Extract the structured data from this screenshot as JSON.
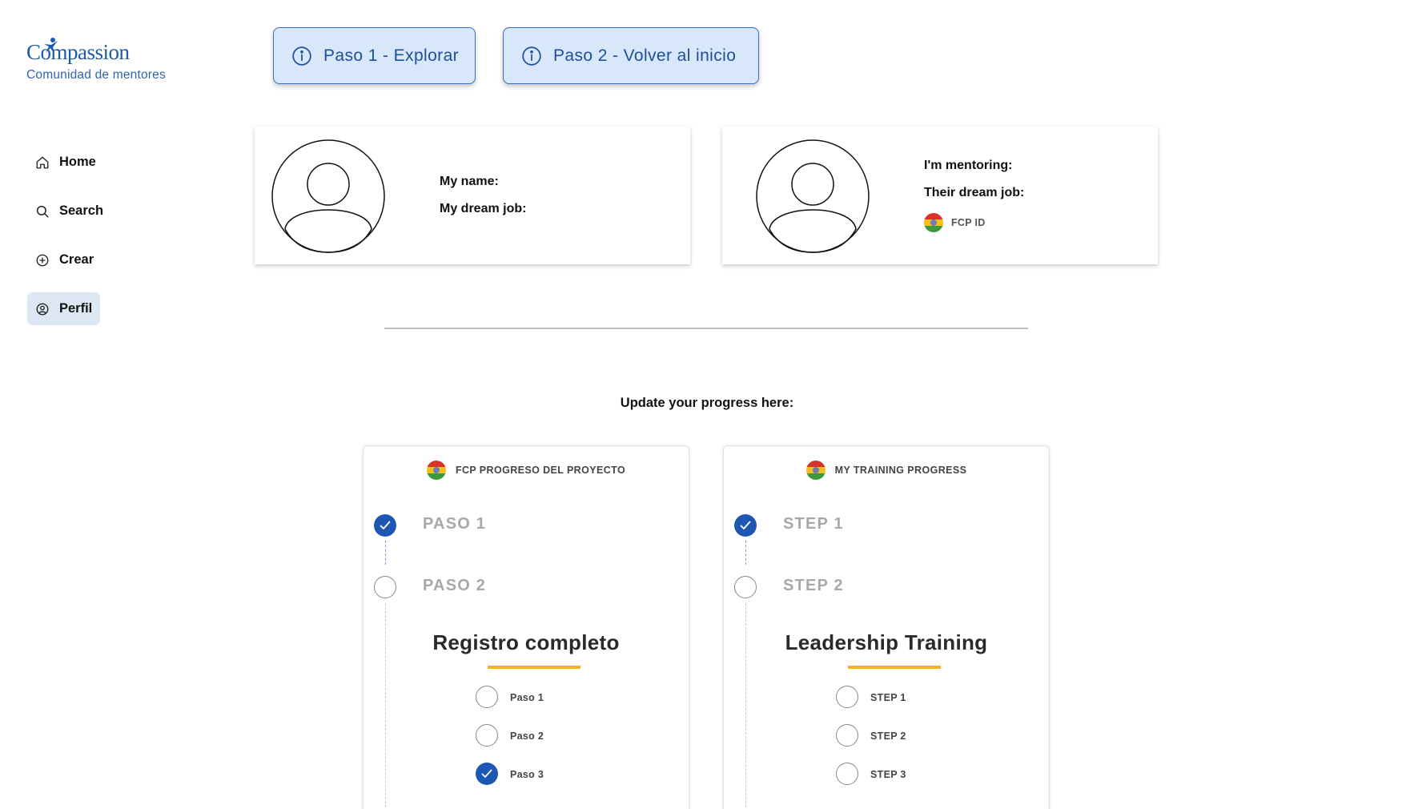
{
  "brand": {
    "name": "Compassion",
    "subtitle": "Comunidad de mentores"
  },
  "sidebar": {
    "items": [
      {
        "label": "Home",
        "icon": "home-icon",
        "active": false
      },
      {
        "label": "Search",
        "icon": "search-icon",
        "active": false
      },
      {
        "label": "Crear",
        "icon": "plus-circle-icon",
        "active": false
      },
      {
        "label": "Perfil",
        "icon": "user-circle-icon",
        "active": true
      }
    ]
  },
  "top_buttons": {
    "step1": "Paso 1 - Explorar",
    "step2": "Paso 2 - Volver al inicio"
  },
  "profile_me": {
    "name_label": "My name:",
    "dream_job_label": "My dream job:"
  },
  "profile_mentee": {
    "mentoring_label": "I'm mentoring:",
    "dream_job_label": "Their dream job:",
    "fcp_id_label": "FCP ID"
  },
  "progress": {
    "prompt": "Update your progress here:",
    "cards": [
      {
        "header": "FCP PROGRESO DEL PROYECTO",
        "steps": [
          {
            "label": "PASO 1",
            "done": true
          },
          {
            "label": "PASO 2",
            "done": false
          }
        ],
        "section_title": "Registro completo",
        "substeps": [
          {
            "label": "Paso 1",
            "done": false
          },
          {
            "label": "Paso 2",
            "done": false
          },
          {
            "label": "Paso 3",
            "done": true
          }
        ]
      },
      {
        "header": "MY TRAINING PROGRESS",
        "steps": [
          {
            "label": "STEP 1",
            "done": true
          },
          {
            "label": "STEP 2",
            "done": false
          }
        ],
        "section_title": "Leadership Training",
        "substeps": [
          {
            "label": "STEP 1",
            "done": false
          },
          {
            "label": "STEP 2",
            "done": false
          },
          {
            "label": "STEP 3",
            "done": false
          }
        ]
      }
    ]
  },
  "colors": {
    "primary": "#1e57b3",
    "accent": "#f2b51e",
    "nav_active_bg": "#dde7f3",
    "button_bg": "#d9e7fb"
  }
}
